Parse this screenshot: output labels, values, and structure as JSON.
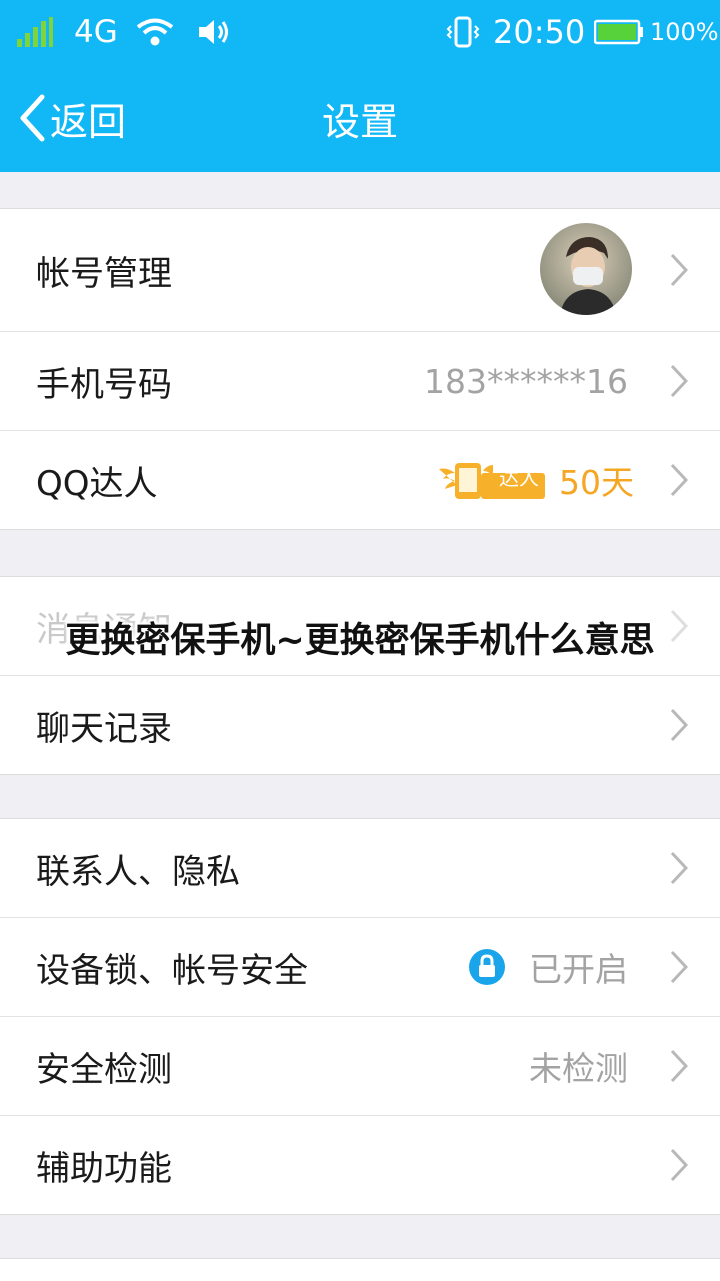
{
  "status_bar": {
    "network": "4G",
    "time": "20:50",
    "battery": "100%"
  },
  "nav": {
    "back_label": "返回",
    "title": "设置"
  },
  "rows": {
    "account": {
      "label": "帐号管理"
    },
    "phone": {
      "label": "手机号码",
      "value": "183******16"
    },
    "qq_daren": {
      "label": "QQ达人",
      "badge_text": "达人",
      "days": "50天"
    },
    "notification": {
      "label": "消息通知"
    },
    "chat_history": {
      "label": "聊天记录"
    },
    "contacts_privacy": {
      "label": "联系人、隐私"
    },
    "device_lock": {
      "label": "设备锁、帐号安全",
      "status": "已开启"
    },
    "security_check": {
      "label": "安全检测",
      "status": "未检测"
    },
    "accessibility": {
      "label": "辅助功能"
    }
  },
  "overlay": {
    "title": "更换密保手机~更换密保手机什么意思"
  },
  "colors": {
    "header": "#12b7f5",
    "accent_orange": "#f5a623",
    "lock_blue": "#1aa4ea"
  }
}
